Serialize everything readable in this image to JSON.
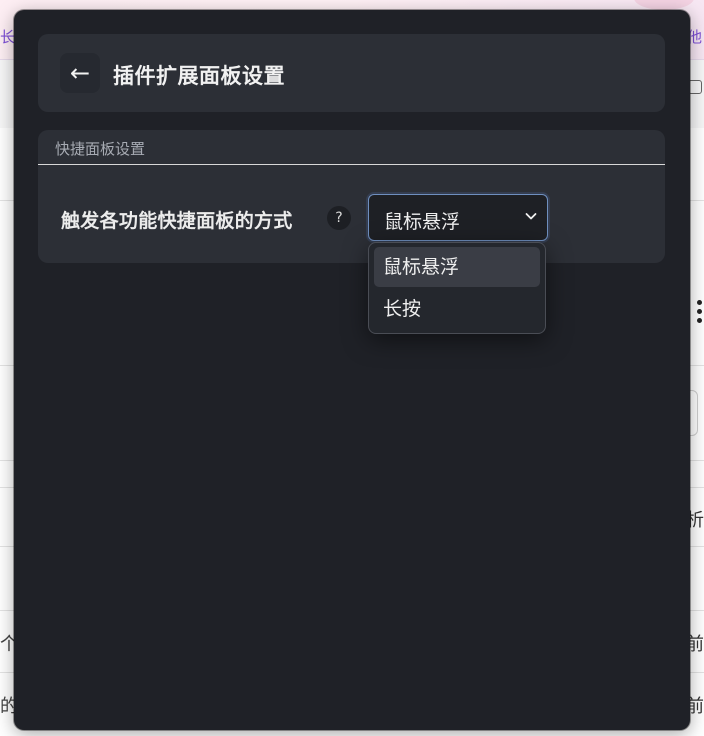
{
  "background": {
    "link_left": "长度",
    "link_right": "他",
    "right_chars": [
      "析",
      "前",
      "前"
    ],
    "left_chars": [
      "个",
      "的"
    ]
  },
  "header": {
    "back_symbol": "←",
    "title": "插件扩展面板设置"
  },
  "section": {
    "title": "快捷面板设置",
    "setting": {
      "label": "触发各功能快捷面板的方式",
      "help_symbol": "?",
      "selected_value": "鼠标悬浮"
    }
  },
  "dropdown": {
    "options": [
      {
        "label": "鼠标悬浮",
        "selected": true
      },
      {
        "label": "长按",
        "selected": false
      }
    ]
  },
  "colors": {
    "panel_bg": "#1f2127",
    "card_bg": "#2c2f36",
    "select_border": "#6f8fbf",
    "option_highlight": "#3a3d45",
    "link_purple": "#7d4fd6"
  }
}
